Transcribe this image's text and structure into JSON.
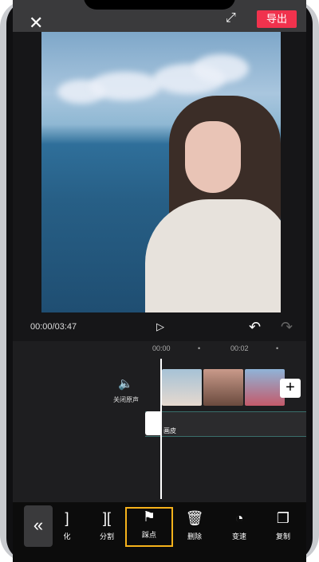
{
  "header": {
    "export_label": "导出"
  },
  "player": {
    "timecode": "00:00/03:47"
  },
  "timeline": {
    "ticks": [
      "00:00",
      "00:02"
    ],
    "mute_label": "关闭原声",
    "audio_label": "画皮"
  },
  "toolbar": {
    "items": [
      {
        "label": "化",
        "icon": "partial-icon"
      },
      {
        "label": "分割",
        "icon": "split-icon"
      },
      {
        "label": "踩点",
        "icon": "flag-icon"
      },
      {
        "label": "删除",
        "icon": "trash-icon"
      },
      {
        "label": "变速",
        "icon": "speed-icon"
      },
      {
        "label": "复制",
        "icon": "copy-icon"
      }
    ],
    "active_color": "#f6b21b"
  },
  "colors": {
    "export_button": "#f0324d",
    "background": "#161618"
  }
}
